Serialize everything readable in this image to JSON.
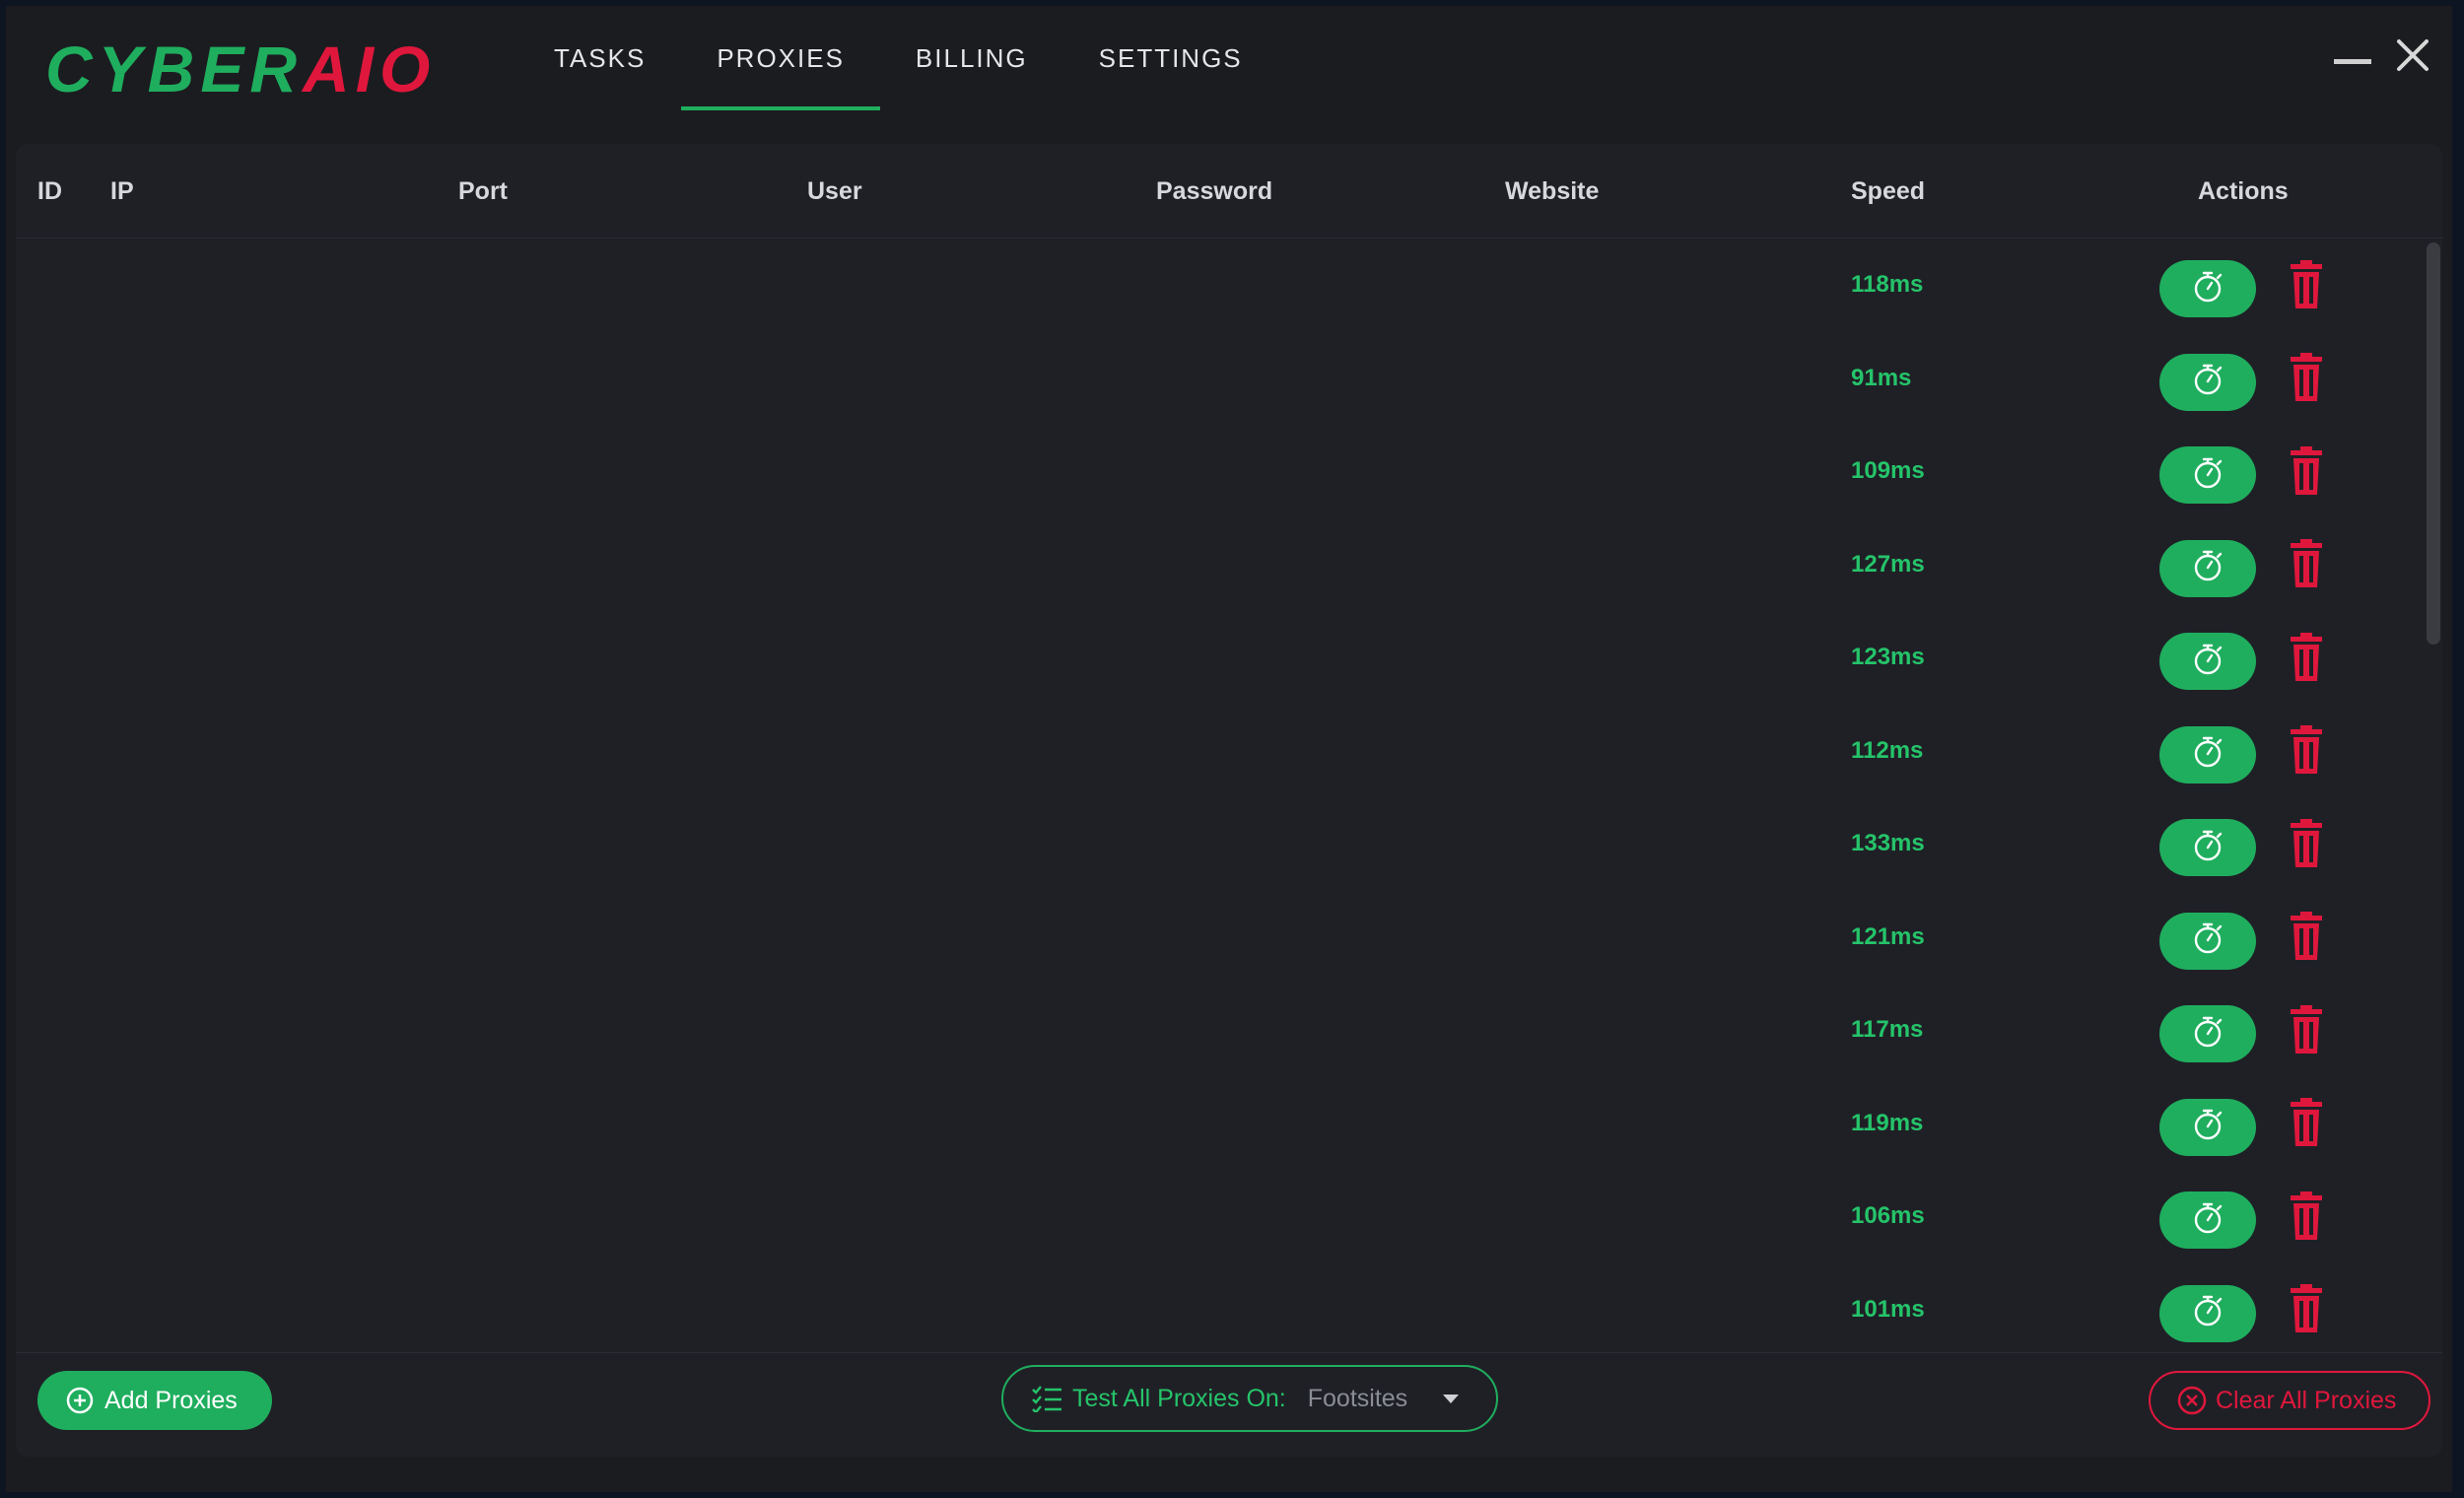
{
  "app": {
    "logo_part1": "CYBER",
    "logo_part2": "AIO",
    "brand_green": "#1fae5e",
    "brand_red": "#e0173c"
  },
  "nav": {
    "tabs": [
      {
        "label": "TASKS"
      },
      {
        "label": "PROXIES",
        "active": true
      },
      {
        "label": "BILLING"
      },
      {
        "label": "SETTINGS"
      }
    ]
  },
  "window_controls": {
    "minimize_icon": "minimize-icon",
    "close_icon": "close-icon"
  },
  "table": {
    "columns": [
      "ID",
      "IP",
      "Port",
      "User",
      "Password",
      "Website",
      "Speed",
      "Actions"
    ],
    "rows": [
      {
        "speed": "118ms"
      },
      {
        "speed": "91ms"
      },
      {
        "speed": "109ms"
      },
      {
        "speed": "127ms"
      },
      {
        "speed": "123ms"
      },
      {
        "speed": "112ms"
      },
      {
        "speed": "133ms"
      },
      {
        "speed": "121ms"
      },
      {
        "speed": "117ms"
      },
      {
        "speed": "119ms"
      },
      {
        "speed": "106ms"
      },
      {
        "speed": "101ms"
      }
    ],
    "row_actions": {
      "test_icon": "stopwatch-icon",
      "delete_icon": "trash-icon"
    }
  },
  "footer": {
    "add_label": "Add Proxies",
    "test_all_label": "Test All Proxies On:",
    "test_all_value": "Footsites",
    "clear_label": "Clear All Proxies"
  }
}
